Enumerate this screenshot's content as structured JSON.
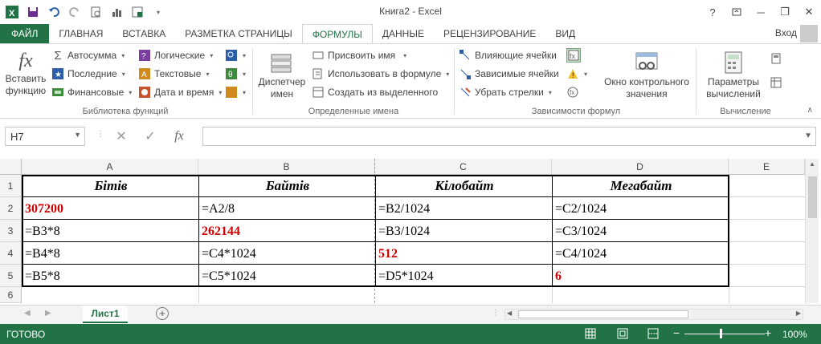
{
  "app": {
    "title": "Книга2 - Excel",
    "signin": "Вход",
    "help": "?",
    "minimize": "─",
    "restore": "❐",
    "close": "✕"
  },
  "tabs": [
    "ФАЙЛ",
    "ГЛАВНАЯ",
    "ВСТАВКА",
    "РАЗМЕТКА СТРАНИЦЫ",
    "ФОРМУЛЫ",
    "ДАННЫЕ",
    "РЕЦЕНЗИРОВАНИЕ",
    "ВИД"
  ],
  "ribbon": {
    "insert_function": "Вставить функцию",
    "autosum": "Автосумма",
    "recent": "Последние",
    "financial": "Финансовые",
    "logical": "Логические",
    "text": "Текстовые",
    "datetime": "Дата и время",
    "library_label": "Библиотека функций",
    "name_manager": "Диспетчер имен",
    "define_name": "Присвоить имя",
    "use_in_formula": "Использовать в формуле",
    "create_from_selection": "Создать из выделенного",
    "defined_names_label": "Определенные имена",
    "trace_precedents": "Влияющие ячейки",
    "trace_dependents": "Зависимые ячейки",
    "remove_arrows": "Убрать стрелки",
    "watch_window": "Окно контрольного значения",
    "auditing_label": "Зависимости формул",
    "calc_options": "Параметры вычислений",
    "calculation_label": "Вычисление"
  },
  "formula_bar": {
    "name_box": "H7",
    "formula": ""
  },
  "columns": [
    "A",
    "B",
    "C",
    "D",
    "E"
  ],
  "rows": [
    "1",
    "2",
    "3",
    "4",
    "5",
    "6"
  ],
  "cells": {
    "A1": "Бітів",
    "B1": "Байтів",
    "C1": "Кілобайт",
    "D1": "Мегабайт",
    "A2": "307200",
    "B2": "=A2/8",
    "C2": "=B2/1024",
    "D2": "=C2/1024",
    "A3": "=B3*8",
    "B3": "262144",
    "C3": "=B3/1024",
    "D3": "=C3/1024",
    "A4": "=B4*8",
    "B4": "=C4*1024",
    "C4": "512",
    "D4": "=C4/1024",
    "A5": "=B5*8",
    "B5": "=C5*1024",
    "C5": "=D5*1024",
    "D5": "6"
  },
  "sheet": {
    "tab": "Лист1",
    "add": "+"
  },
  "status": {
    "ready": "ГОТОВО",
    "zoom": "100%"
  },
  "colors": {
    "accent": "#217346",
    "highlight": "#cc0000"
  }
}
